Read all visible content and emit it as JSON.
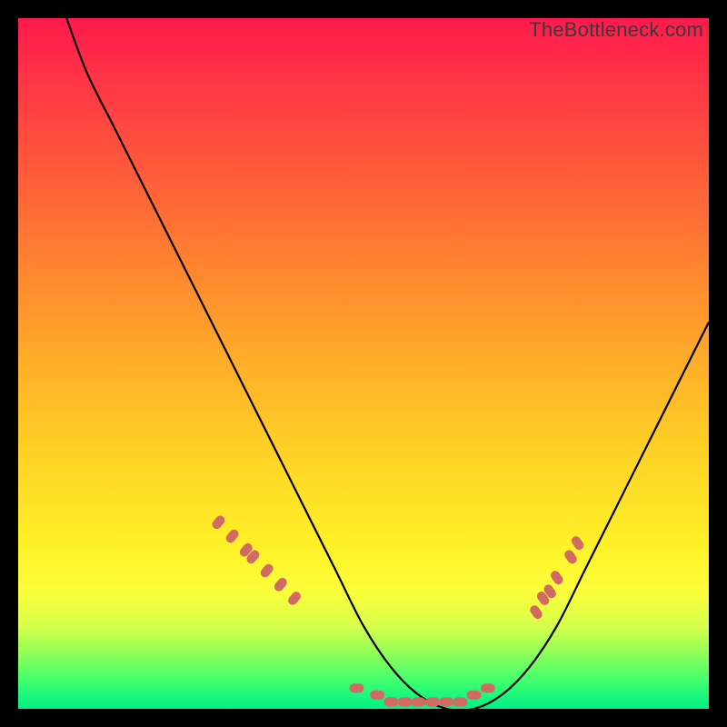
{
  "watermark": "TheBottleneck.com",
  "chart_data": {
    "type": "line",
    "title": "",
    "xlabel": "",
    "ylabel": "",
    "xlim": [
      0,
      100
    ],
    "ylim": [
      0,
      100
    ],
    "series": [
      {
        "name": "bottleneck-curve",
        "x": [
          7,
          10,
          14,
          18,
          22,
          26,
          30,
          34,
          38,
          42,
          46,
          50,
          54,
          58,
          62,
          66,
          70,
          74,
          78,
          82,
          86,
          90,
          94,
          98,
          100
        ],
        "y": [
          100,
          92,
          84,
          76,
          68,
          60,
          52,
          44,
          36,
          28,
          20,
          12,
          6,
          2,
          0,
          0,
          2,
          6,
          12,
          20,
          28,
          36,
          44,
          52,
          56
        ]
      }
    ],
    "markers": [
      {
        "name": "left-cluster",
        "color": "#d06a62",
        "points": [
          {
            "x": 29,
            "y": 27
          },
          {
            "x": 31,
            "y": 25
          },
          {
            "x": 33,
            "y": 23
          },
          {
            "x": 34,
            "y": 22
          },
          {
            "x": 36,
            "y": 20
          },
          {
            "x": 38,
            "y": 18
          },
          {
            "x": 40,
            "y": 16
          }
        ]
      },
      {
        "name": "bottom-cluster",
        "color": "#d06a62",
        "points": [
          {
            "x": 49,
            "y": 3
          },
          {
            "x": 52,
            "y": 2
          },
          {
            "x": 54,
            "y": 1
          },
          {
            "x": 56,
            "y": 1
          },
          {
            "x": 58,
            "y": 1
          },
          {
            "x": 60,
            "y": 1
          },
          {
            "x": 62,
            "y": 1
          },
          {
            "x": 64,
            "y": 1
          },
          {
            "x": 66,
            "y": 2
          },
          {
            "x": 68,
            "y": 3
          }
        ]
      },
      {
        "name": "right-cluster",
        "color": "#d06a62",
        "points": [
          {
            "x": 75,
            "y": 14
          },
          {
            "x": 76,
            "y": 16
          },
          {
            "x": 77,
            "y": 17
          },
          {
            "x": 78,
            "y": 19
          },
          {
            "x": 80,
            "y": 22
          },
          {
            "x": 81,
            "y": 24
          }
        ]
      }
    ],
    "gradient_stops": [
      {
        "pos": 0,
        "color": "#ff1a4c"
      },
      {
        "pos": 50,
        "color": "#ffd028"
      },
      {
        "pos": 100,
        "color": "#00f08a"
      }
    ]
  }
}
